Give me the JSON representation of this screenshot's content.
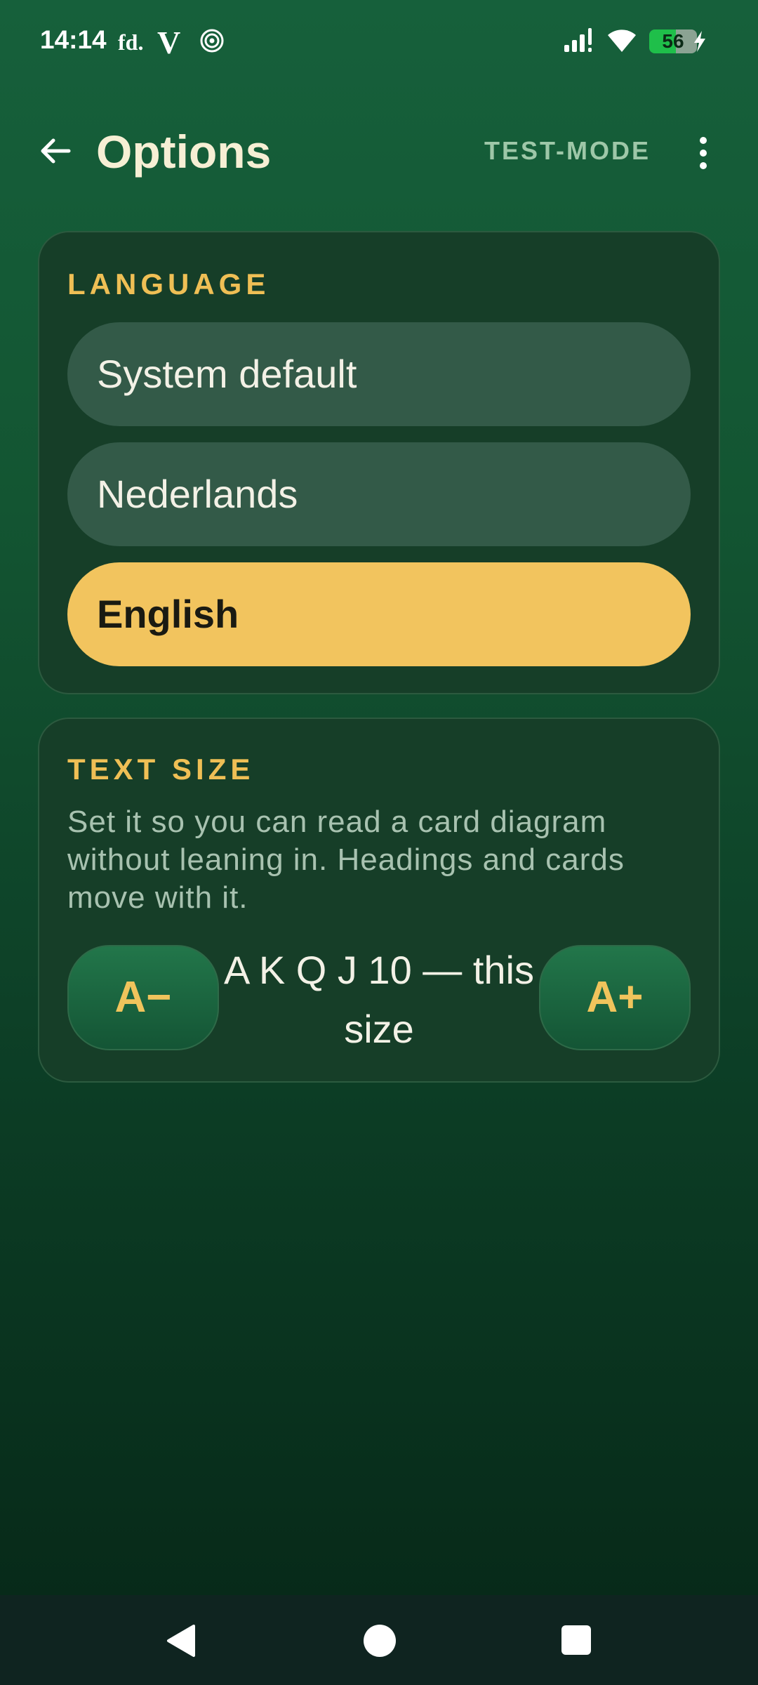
{
  "status_bar": {
    "time": "14:14",
    "app_fd": "fd.",
    "app_v": "V",
    "battery": "56",
    "icons": [
      "spiral-icon",
      "signal-icon",
      "wifi-icon",
      "battery-icon",
      "charging-bolt-icon"
    ]
  },
  "header": {
    "back_icon": "arrow-left-icon",
    "title": "Options",
    "test_mode": "TEST-MODE",
    "more_icon": "more-vertical-icon"
  },
  "language": {
    "heading": "LANGUAGE",
    "options": [
      {
        "label": "System default",
        "selected": false
      },
      {
        "label": "Nederlands",
        "selected": false
      },
      {
        "label": "English",
        "selected": true
      }
    ]
  },
  "text_size": {
    "heading": "TEXT SIZE",
    "description": "Set it so you can read a card diagram without leaning in. Headings and cards move with it.",
    "decrease_label": "A−",
    "increase_label": "A+",
    "preview": "A K Q J 10 — this size"
  },
  "nav_bar": {
    "icons": [
      "nav-back-icon",
      "nav-home-icon",
      "nav-recents-icon"
    ]
  },
  "colors": {
    "accent": "#f2c45e",
    "heading": "#efbf55",
    "card_bg": "#163e28",
    "option_bg": "#335a48",
    "muted_text": "#a8c2b0"
  }
}
